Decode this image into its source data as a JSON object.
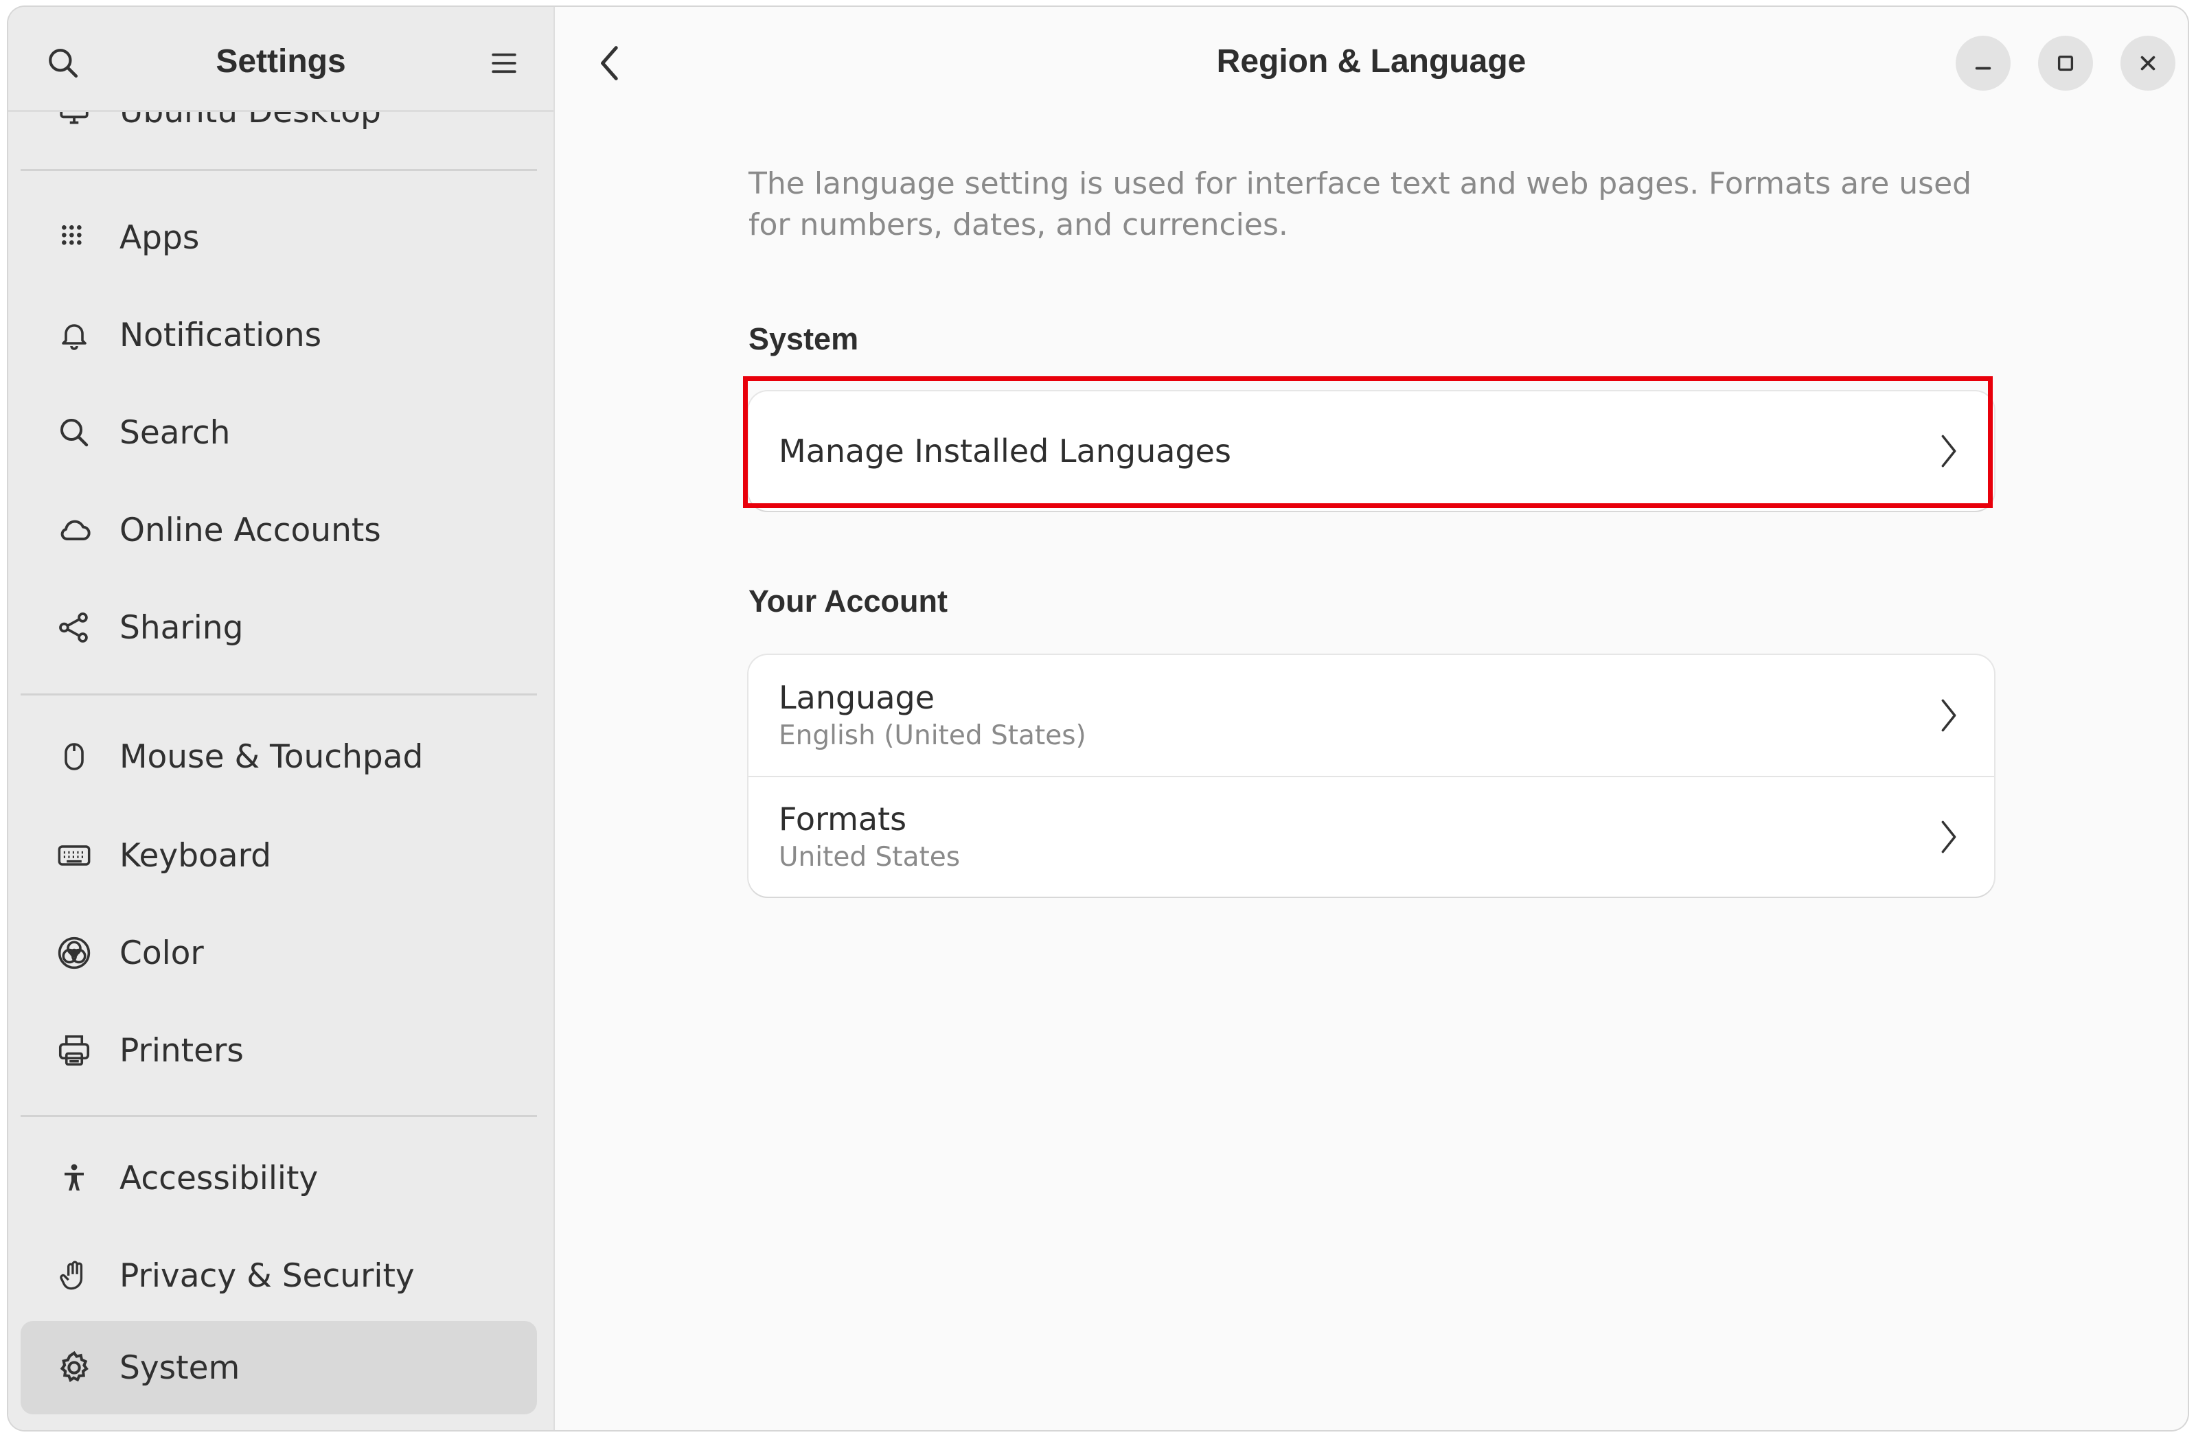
{
  "sidebar": {
    "title": "Settings",
    "partial_item_label": "Ubuntu Desktop",
    "items": [
      {
        "label": "Apps",
        "icon": "apps-grid-icon"
      },
      {
        "label": "Notifications",
        "icon": "bell-icon"
      },
      {
        "label": "Search",
        "icon": "search-icon"
      },
      {
        "label": "Online Accounts",
        "icon": "cloud-icon"
      },
      {
        "label": "Sharing",
        "icon": "share-icon"
      },
      {
        "label": "Mouse & Touchpad",
        "icon": "mouse-icon"
      },
      {
        "label": "Keyboard",
        "icon": "keyboard-icon"
      },
      {
        "label": "Color",
        "icon": "color-icon"
      },
      {
        "label": "Printers",
        "icon": "printer-icon"
      },
      {
        "label": "Accessibility",
        "icon": "accessibility-icon"
      },
      {
        "label": "Privacy & Security",
        "icon": "hand-icon"
      },
      {
        "label": "System",
        "icon": "gear-icon",
        "selected": true
      }
    ]
  },
  "header": {
    "title": "Region & Language"
  },
  "main": {
    "description": "The language setting is used for interface text and web pages. Formats are used for numbers, dates, and currencies.",
    "system_section": {
      "title": "System",
      "rows": [
        {
          "title": "Manage Installed Languages"
        }
      ]
    },
    "account_section": {
      "title": "Your Account",
      "rows": [
        {
          "title": "Language",
          "subtitle": "English (United States)"
        },
        {
          "title": "Formats",
          "subtitle": "United States"
        }
      ]
    }
  },
  "colors": {
    "highlight": "#e8000b",
    "sidebar_bg": "#ebebeb",
    "selected_bg": "#d9d9d9"
  }
}
